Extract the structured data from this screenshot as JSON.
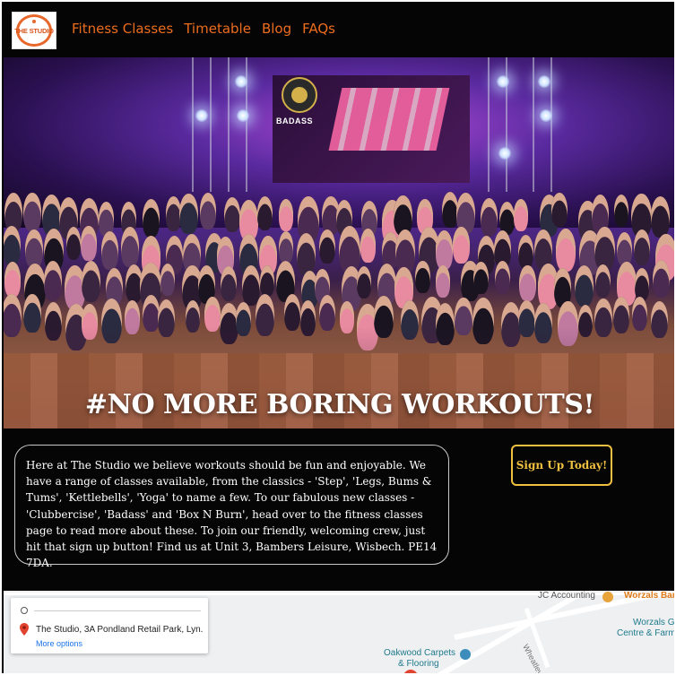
{
  "navbar": {
    "logo_text": "THE STUDIO",
    "links": [
      "Fitness Classes",
      "Timetable",
      "Blog",
      "FAQs"
    ]
  },
  "hero": {
    "title": "#NO MORE BORING WORKOUTS!",
    "stage_sign": "BADASS"
  },
  "intro": {
    "text": "Here at The Studio we believe workouts should be fun and enjoyable. We have a range of classes available, from the classics - 'Step', 'Legs, Bums & Tums', 'Kettlebells', 'Yoga' to name a few. To our fabulous new classes - 'Clubbercise', 'Badass' and 'Box N Burn', head over to the fitness classes page to read more about these. To join our friendly, welcoming crew, just hit that sign up button! Find us at Unit 3, Bambers Leisure, Wisbech. PE14 7DA."
  },
  "signup_label": "Sign Up Today!",
  "map": {
    "address": "The Studio, 3A Pondland Retail Park, Lyn...",
    "more_options": "More options",
    "labels": {
      "jc_accounting": "JC Accounting",
      "worzals_bar": "Worzals Bar",
      "worzals_garden_line1": "Worzals G",
      "worzals_garden_line2": "Centre & Farm",
      "oakwood_line1": "Oakwood Carpets",
      "oakwood_line2": "& Flooring",
      "wheatley_bank": "Wheatley Bank"
    }
  },
  "colors": {
    "nav_link": "#ec6d1e",
    "signup_accent": "#f0c040",
    "background": "#050505"
  }
}
